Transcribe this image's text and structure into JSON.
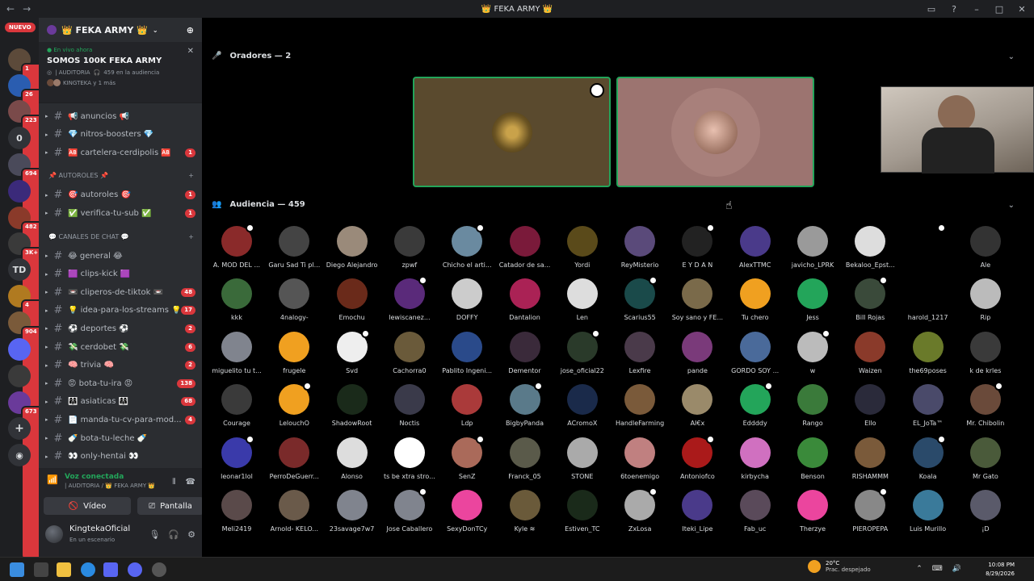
{
  "titlebar": {
    "title": "👑 FEKA ARMY 👑"
  },
  "rail": {
    "nuevo": "NUEVO",
    "servers": [
      {
        "badge": "1",
        "color": "#5c4a3a",
        "text": ""
      },
      {
        "badge": "26",
        "color": "#2a5db0",
        "text": ""
      },
      {
        "badge": "223",
        "color": "#7a4a4a",
        "text": ""
      },
      {
        "badge": "",
        "color": "#313338",
        "text": "0"
      },
      {
        "badge": "694",
        "color": "#4a4a5a",
        "text": ""
      },
      {
        "badge": "",
        "color": "#3b2a7a",
        "text": ""
      },
      {
        "badge": "482",
        "color": "#8a3a2a",
        "text": ""
      },
      {
        "badge": "3K+",
        "color": "#3a3a3a",
        "text": ""
      },
      {
        "badge": "",
        "color": "#313338",
        "text": "TD"
      },
      {
        "badge": "4",
        "color": "#b07a20",
        "text": ""
      },
      {
        "badge": "904",
        "color": "#7a5a3a",
        "text": ""
      },
      {
        "badge": "",
        "color": "#5865f2",
        "text": ""
      },
      {
        "badge": "",
        "color": "#3a3a3a",
        "text": ""
      },
      {
        "badge": "673",
        "color": "#6a3a9a",
        "text": ""
      }
    ]
  },
  "sidebar": {
    "guild_name": "👑 FEKA ARMY 👑",
    "live": {
      "status": "En vivo ahora",
      "title": "SOMOS 100K FEKA ARMY",
      "channel": "| AUDITORIA",
      "audience": "459 en la audiencia",
      "users": "KINGTEKA y 1 más"
    },
    "channels": [
      {
        "name": "📢 anuncios 📢",
        "badge": "",
        "icon": "speaker-icon"
      },
      {
        "name": "💎 nitros-boosters 💎",
        "badge": "",
        "icon": "hash-icon"
      },
      {
        "name": "🆎 cartelera-cerdipolis 🆎",
        "badge": "1",
        "icon": "hash-icon"
      }
    ],
    "cat1": "📌 AUTOROLES 📌",
    "channels2": [
      {
        "name": "🎯 autoroles 🎯",
        "badge": "1"
      },
      {
        "name": "✅ verifica-tu-sub ✅",
        "badge": "1"
      }
    ],
    "cat2": "💬 CANALES DE CHAT 💬",
    "channels3": [
      {
        "name": "😂 general 😂",
        "badge": ""
      },
      {
        "name": "🟪 clips-kick 🟪",
        "badge": ""
      },
      {
        "name": "📼 cliperos-de-tiktok 📼",
        "badge": "48"
      },
      {
        "name": "💡 idea-para-los-streams 💡",
        "badge": "17"
      },
      {
        "name": "⚽ deportes ⚽",
        "badge": "2"
      },
      {
        "name": "💸 cerdobet 💸",
        "badge": "6"
      },
      {
        "name": "🧠 trivia 🧠",
        "badge": "2"
      },
      {
        "name": "😡 bota-tu-ira 😡",
        "badge": "138"
      },
      {
        "name": "👩‍👩‍👧 asiaticas 👩‍👩‍👧",
        "badge": "68"
      },
      {
        "name": "📄 manda-tu-cv-para-mod...",
        "badge": "4"
      },
      {
        "name": "🍼 bota-tu-leche 🍼",
        "badge": ""
      },
      {
        "name": "👀 only-hentai 👀",
        "badge": ""
      }
    ],
    "voice": {
      "status": "Voz conectada",
      "channel": "| AUDITORIA / 👑 FEKA ARMY 👑",
      "video": "Vídeo",
      "screen": "Pantalla"
    },
    "user": {
      "name": "KingtekaOficial",
      "status": "En un escenario"
    }
  },
  "stage": {
    "speakers_label": "Oradores — 2",
    "audience_label": "Audiencia — 459",
    "members": [
      [
        "A. MOD DEL ...",
        "Garu Sad Ti pl...",
        "Diego Alejandro",
        "zpwf",
        "Chicho el arti...",
        "Catador de sa...",
        "Yordi",
        "ReyMisterio",
        "E Y D A N",
        "AlexTTMC",
        "javicho_LPRK",
        "Bekaloo_Epst...",
        "",
        "Ale"
      ],
      [
        "kkk",
        "4nalogy-",
        "Emochu",
        "lewiscanez...",
        "DOFFY",
        "Dantalion",
        "Len",
        "Scarius55",
        "Soy sano y FE...",
        "Tu chero",
        "Jess",
        "Bill Rojas",
        "harold_1217",
        "Rip"
      ],
      [
        "miguelito tu t...",
        "frugele",
        "Svd",
        "Cachorra0",
        "Pablito Ingeni...",
        "Dementor",
        "jose_oficial22",
        "Lexfire",
        "pande",
        "GORDO SOY ...",
        "w",
        "Waizen",
        "the69poses",
        "k de krles"
      ],
      [
        "Courage",
        "LelouchO",
        "ShadowRoot",
        "Noctis",
        "Ldp",
        "BigbyPanda",
        "ACromoX",
        "HandleFarming",
        "AI€x",
        "Eddddy",
        "Rango",
        "Ello",
        "EL_JoTa™",
        "Mr. Chibolin"
      ],
      [
        "leonar1lol",
        "PerroDeGuerr...",
        "Alonso",
        "ts be xtra stro...",
        "Sen⁠Z",
        "Franck_05",
        "STONE",
        "6toenemigo",
        "Antoniofco",
        "kirbycha",
        "Benson",
        "RISHAMMM",
        "Koala",
        "Mr Gato"
      ],
      [
        "Meli2419",
        "Arnold- KELO...",
        "23savage7w7",
        "Jose Caballero",
        "SexyDonTCy",
        "Kyle ≋",
        "Estiven_TC",
        "ZxLosa",
        "Iteki_Lipe",
        "Fab_uc",
        "Therzye",
        "PIEROPEPA",
        "Luis Murillo",
        "¡D"
      ]
    ],
    "avatar_colors": [
      [
        "#8a2a2a",
        "#444",
        "#9a8a7a",
        "#3a3a3a",
        "#6a8aa0",
        "#7a1a3a",
        "#5a4a1a",
        "#5a4a7a",
        "#222",
        "#4a3a8a",
        "#9a9a9a",
        "#ddd",
        "#000",
        "#333"
      ],
      [
        "#3a6a3a",
        "#555",
        "#6a2a1a",
        "#5a2a7a",
        "#ccc",
        "#aa2255",
        "#ddd",
        "#1a4a4a",
        "#7a6a4a",
        "#f0a020",
        "#23a55a",
        "#3a4a3a",
        "#000",
        "#bbb"
      ],
      [
        "#80848e",
        "#f0a020",
        "#eee",
        "#6a5a3a",
        "#2a4a8a",
        "#3a2a3a",
        "#2a3a2a",
        "#4a3a4a",
        "#7a3a7a",
        "#4a6a9a",
        "#bbb",
        "#8a3a2a",
        "#6a7a2a",
        "#3a3a3a"
      ],
      [
        "#3a3a3a",
        "#f0a020",
        "#1a2a1a",
        "#3a3a4a",
        "#aa3a3a",
        "#5a7a8a",
        "#1a2a4a",
        "#7a5a3a",
        "#9a8a6a",
        "#23a55a",
        "#3a7a3a",
        "#2a2a3a",
        "#4a4a6a",
        "#6a4a3a"
      ],
      [
        "#3a3aaa",
        "#7a2a2a",
        "#ddd",
        "#fff",
        "#aa6a5a",
        "#5a5a4a",
        "#aaa",
        "#c08080",
        "#aa1a1a",
        "#d070c0",
        "#3a8a3a",
        "#7a5a3a",
        "#2a4a6a",
        "#4a5a3a"
      ],
      [
        "#5a4a4a",
        "#6a5a4a",
        "#80848e",
        "#80848e",
        "#eb459e",
        "#6a5a3a",
        "#1a2a1a",
        "#aaa",
        "#4a3a8a",
        "#5a4a5a",
        "#eb459e",
        "#888",
        "#3a7a9a",
        "#5a5a6a"
      ]
    ]
  },
  "taskbar": {
    "temp": "20°C",
    "weather": "Prac. despejado",
    "time": "10:08 PM",
    "date": "8/29/2026"
  }
}
